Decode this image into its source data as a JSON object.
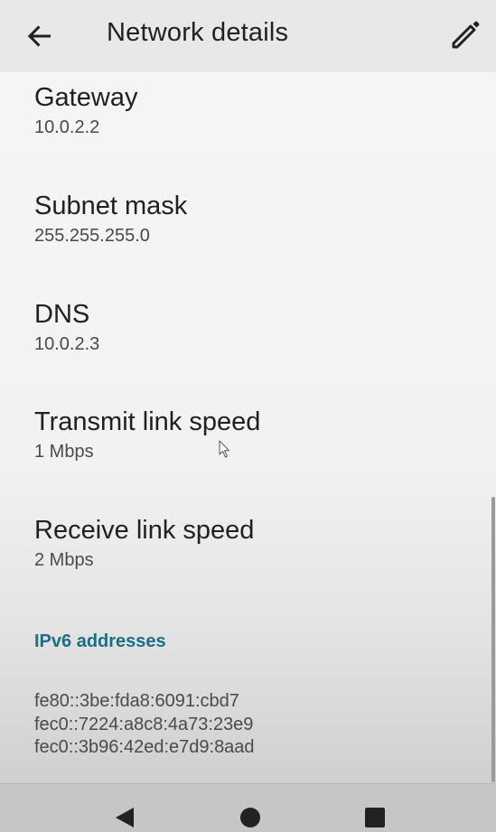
{
  "appbar": {
    "title": "Network details",
    "back_icon": "arrow-left-icon",
    "edit_icon": "pencil-icon"
  },
  "details": [
    {
      "label": "Gateway",
      "value": "10.0.2.2"
    },
    {
      "label": "Subnet mask",
      "value": "255.255.255.0"
    },
    {
      "label": "DNS",
      "value": "10.0.2.3"
    },
    {
      "label": "Transmit link speed",
      "value": "1 Mbps"
    },
    {
      "label": "Receive link speed",
      "value": "2 Mbps"
    }
  ],
  "ipv6": {
    "header": "IPv6 addresses",
    "addresses": [
      "fe80::3be:fda8:6091:cbd7",
      "fec0::7224:a8c8:4a73:23e9",
      "fec0::3b96:42ed:e7d9:8aad"
    ]
  },
  "navbar": {
    "back_icon": "triangle-back-icon",
    "home_icon": "circle-home-icon",
    "recents_icon": "square-recents-icon"
  },
  "colors": {
    "accent": "#1a6f86",
    "appbar_bg": "#e8e8e8",
    "navbar_bg": "#c6c6c6"
  }
}
